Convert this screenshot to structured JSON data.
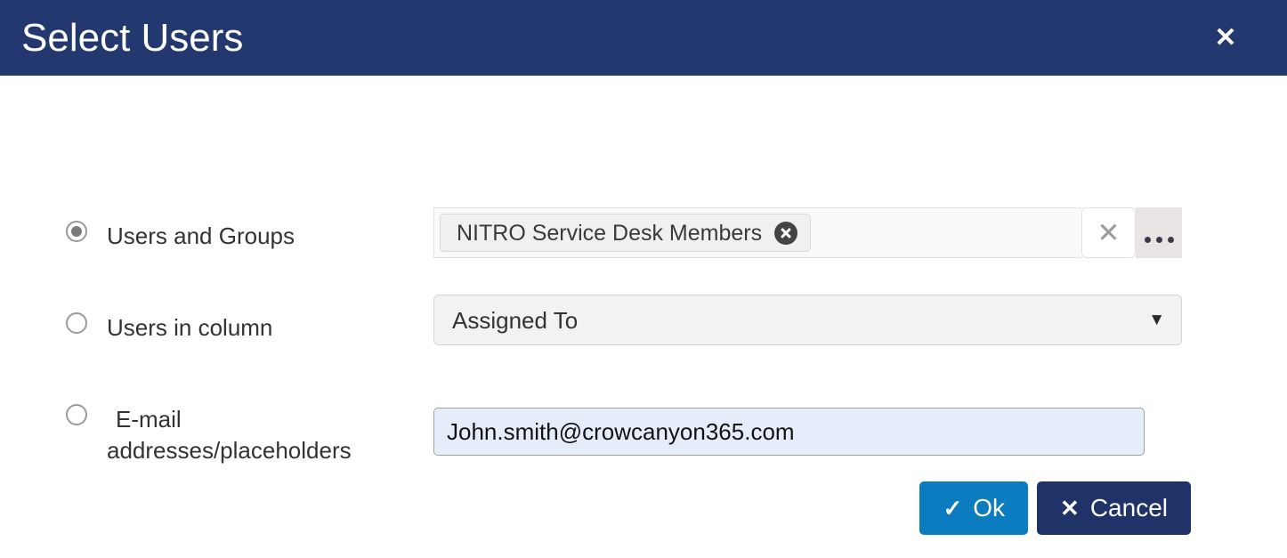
{
  "dialog": {
    "title": "Select Users",
    "close_icon": "close-icon"
  },
  "options": [
    {
      "id": "users-and-groups",
      "label": "Users and Groups",
      "selected": true
    },
    {
      "id": "users-in-column",
      "label": "Users in column",
      "selected": false
    },
    {
      "id": "email-addresses",
      "label": "E-mail\naddresses/placeholders",
      "selected": false
    }
  ],
  "people_picker": {
    "token_label": "NITRO Service Desk Members",
    "token_remove_icon": "remove-circle-icon",
    "input_value": "",
    "input_placeholder": "",
    "clear_icon": "close-icon",
    "browse_icon": "ellipsis-icon"
  },
  "column_select": {
    "value": "Assigned To",
    "arrow_icon": "chevron-down-icon"
  },
  "email_field": {
    "value": "John.smith@crowcanyon365.com",
    "placeholder": ""
  },
  "footer": {
    "ok_label": "Ok",
    "ok_icon": "check-icon",
    "cancel_label": "Cancel",
    "cancel_icon": "close-icon"
  },
  "colors": {
    "header_navy": "#23386e",
    "ok_blue": "#0c7cc0",
    "cancel_navy": "#1f3368",
    "email_field_bg": "#e6edfa"
  }
}
